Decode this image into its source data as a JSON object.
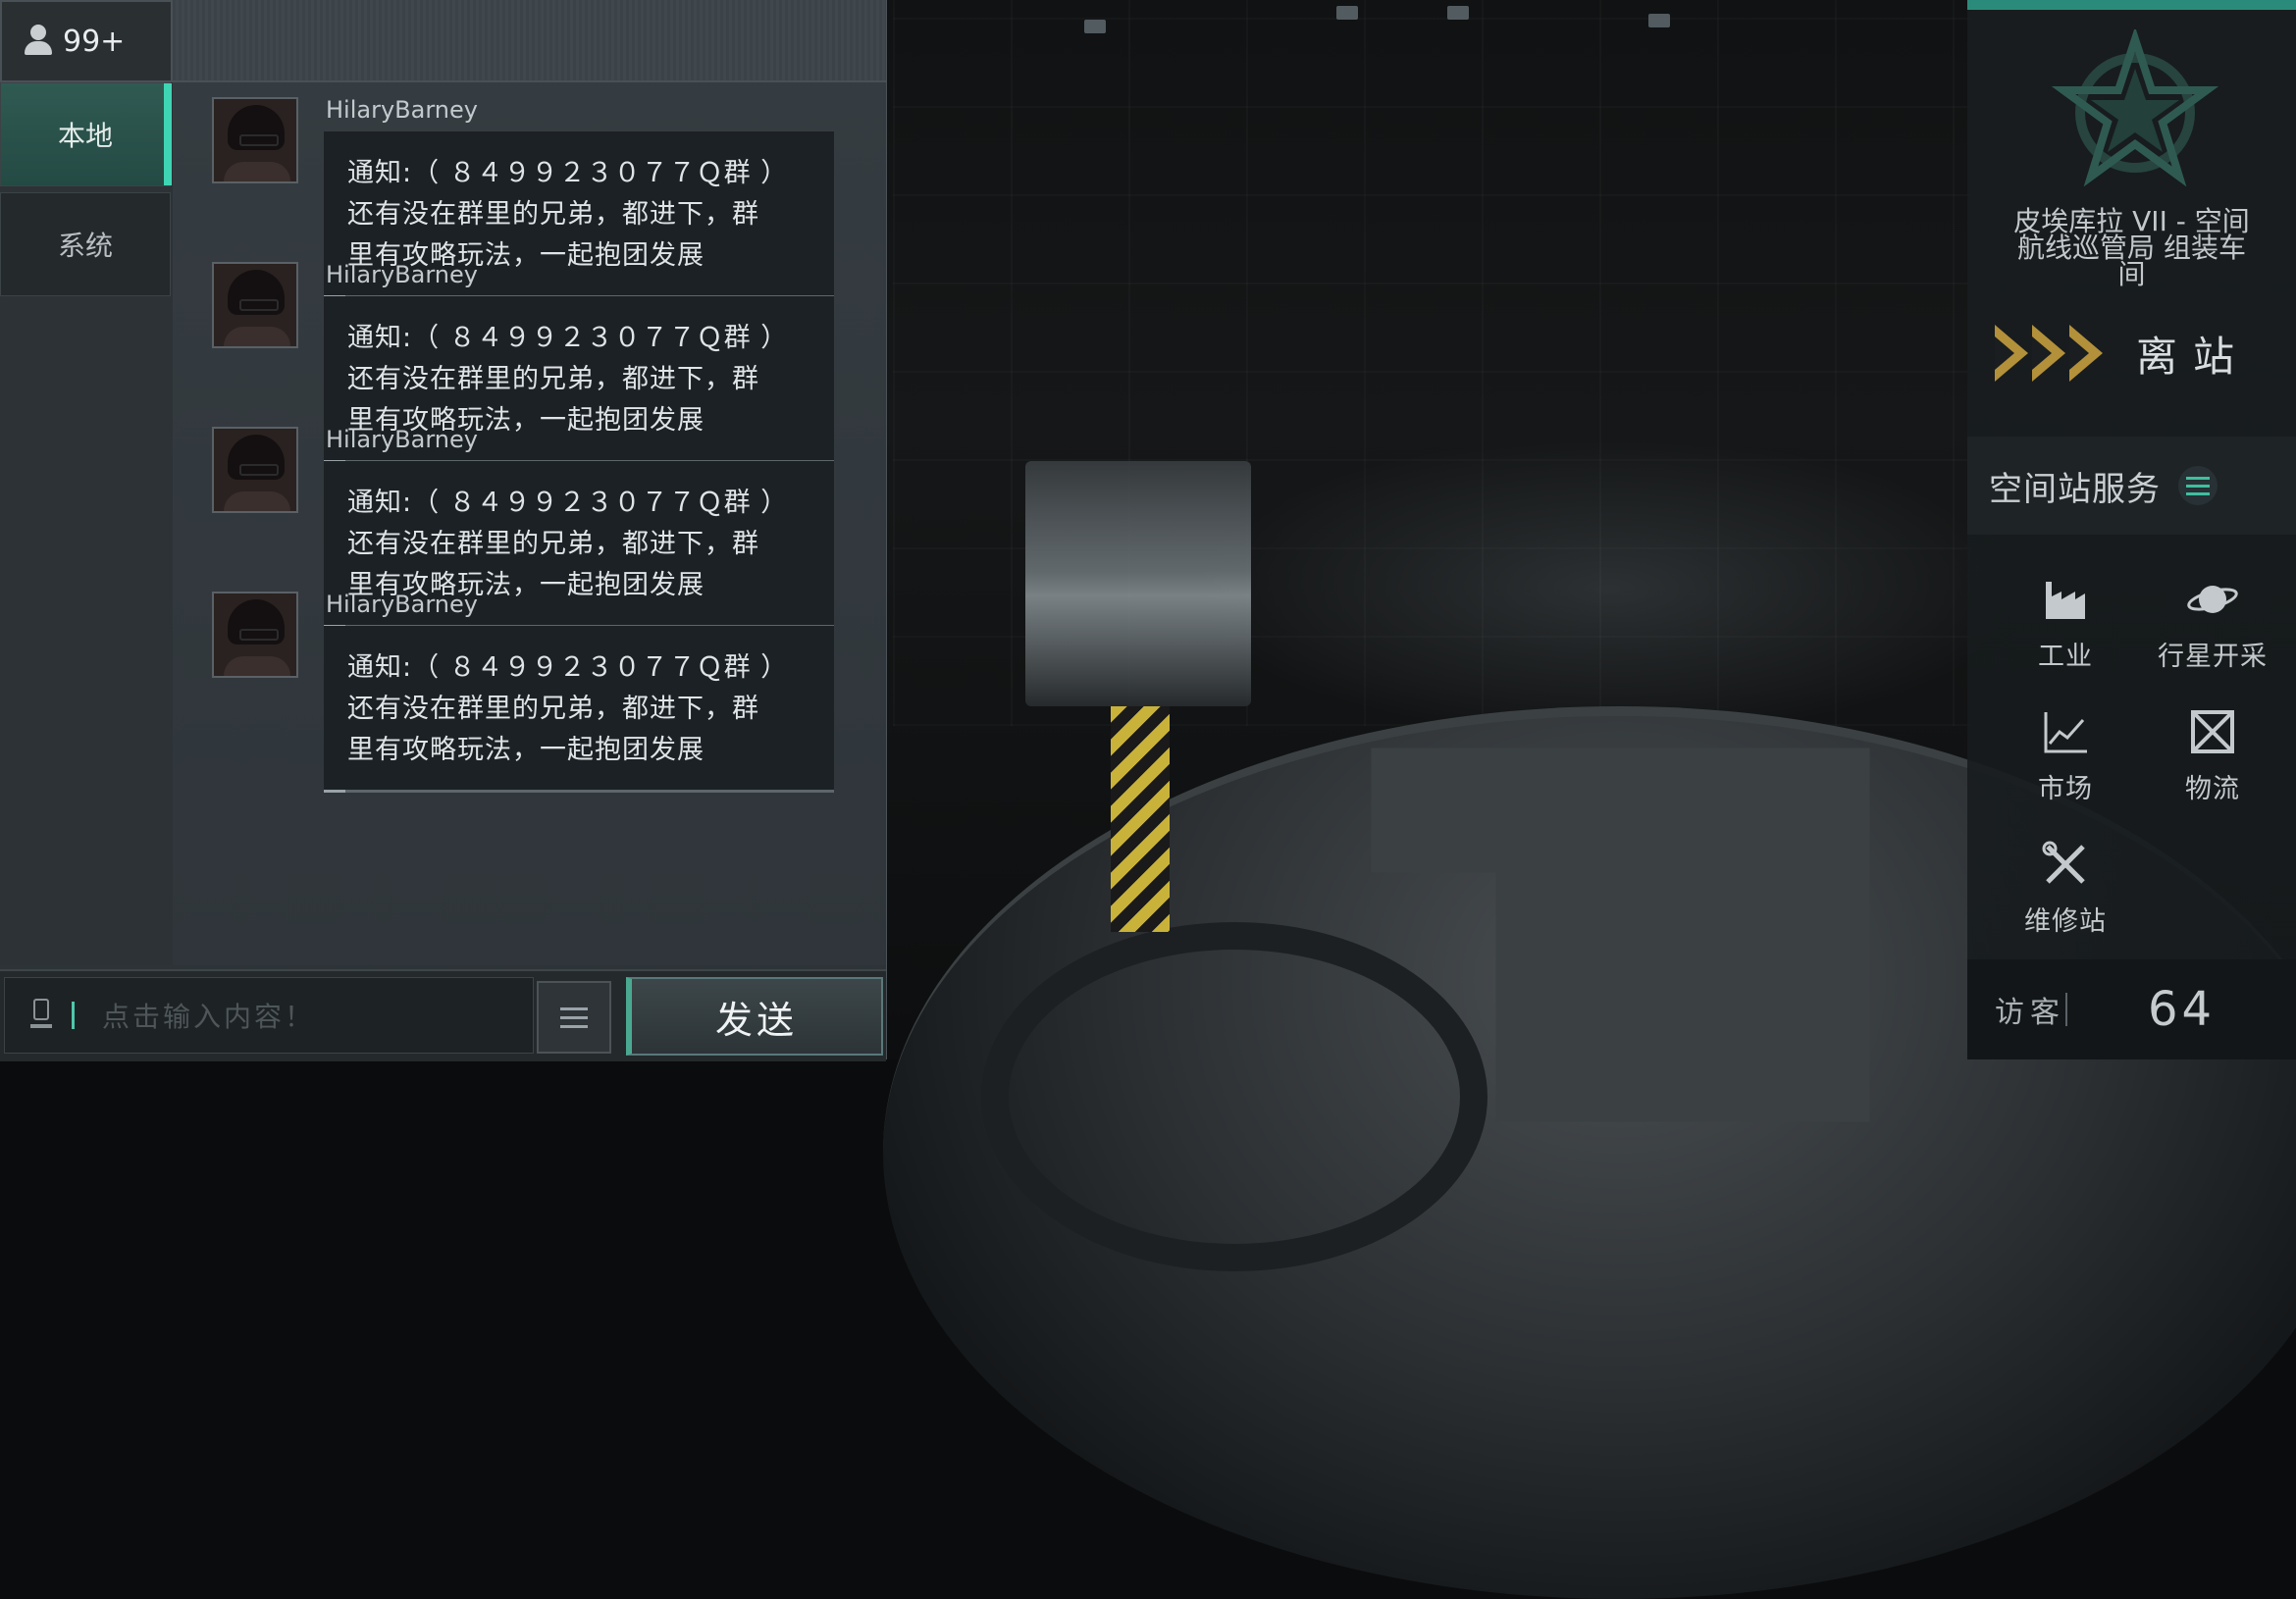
{
  "chat": {
    "online_count": "99+",
    "tabs": [
      {
        "label": "本地",
        "active": true
      },
      {
        "label": "系统",
        "active": false
      }
    ],
    "messages": [
      {
        "sender": "HilaryBarney",
        "lines": [
          "通知:（ ８４９９２３０７７Ｑ群 ）",
          "还有没在群里的兄弟，都进下，群",
          "里有攻略玩法，一起抱团发展"
        ]
      },
      {
        "sender": "HilaryBarney",
        "lines": [
          "通知:（ ８４９９２３０７７Ｑ群 ）",
          "还有没在群里的兄弟，都进下，群",
          "里有攻略玩法，一起抱团发展"
        ]
      },
      {
        "sender": "HilaryBarney",
        "lines": [
          "通知:（ ８４９９２３０７７Ｑ群 ）",
          "还有没在群里的兄弟，都进下，群",
          "里有攻略玩法，一起抱团发展"
        ]
      },
      {
        "sender": "HilaryBarney",
        "lines": [
          "通知:（ ８４９９２３０７７Ｑ群 ）",
          "还有没在群里的兄弟，都进下，群",
          "里有攻略玩法，一起抱团发展"
        ]
      }
    ],
    "input_placeholder": "点击输入内容！",
    "send_label": "发送"
  },
  "station": {
    "name_lines": [
      "皮埃库拉 VII - 空间",
      "航线巡管局 组装车",
      "间"
    ],
    "undock_label": "离站",
    "services_label": "空间站服务",
    "services": [
      {
        "label": "工业",
        "icon": "factory-icon"
      },
      {
        "label": "行星开采",
        "icon": "planet-icon"
      },
      {
        "label": "市场",
        "icon": "chart-icon"
      },
      {
        "label": "物流",
        "icon": "crate-icon"
      },
      {
        "label": "维修站",
        "icon": "wrench-icon"
      }
    ],
    "visitors_label": "访客",
    "visitors_count": "64"
  },
  "colors": {
    "accent_teal": "#3fd5b4",
    "undock_gold": "#b3903a"
  }
}
